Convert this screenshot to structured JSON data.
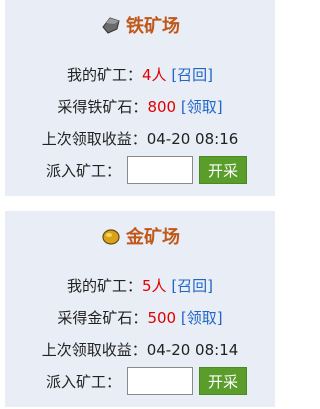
{
  "iron": {
    "title": "铁矿场",
    "icon": "iron-ore-icon",
    "miners_label": "我的矿工：",
    "miners_count": "4人",
    "recall_link": "[召回]",
    "ore_label": "采得铁矿石：",
    "ore_value": "800",
    "collect_link": "[领取]",
    "last_collect": "上次领取收益：04-20 08:16",
    "dispatch_label": "派入矿工：",
    "dispatch_value": "",
    "mine_button": "开采"
  },
  "gold": {
    "title": "金矿场",
    "icon": "gold-ore-icon",
    "miners_label": "我的矿工：",
    "miners_count": "5人",
    "recall_link": "[召回]",
    "ore_label": "采得金矿石：",
    "ore_value": "500",
    "collect_link": "[领取]",
    "last_collect": "上次领取收益：04-20 08:14",
    "dispatch_label": "派入矿工：",
    "dispatch_value": "",
    "mine_button": "开采"
  },
  "colors": {
    "title": "#c0581a",
    "highlight": "#e00000",
    "link": "#1f66c6",
    "button": "#5a9d2b",
    "panel": "#e9edf5"
  }
}
